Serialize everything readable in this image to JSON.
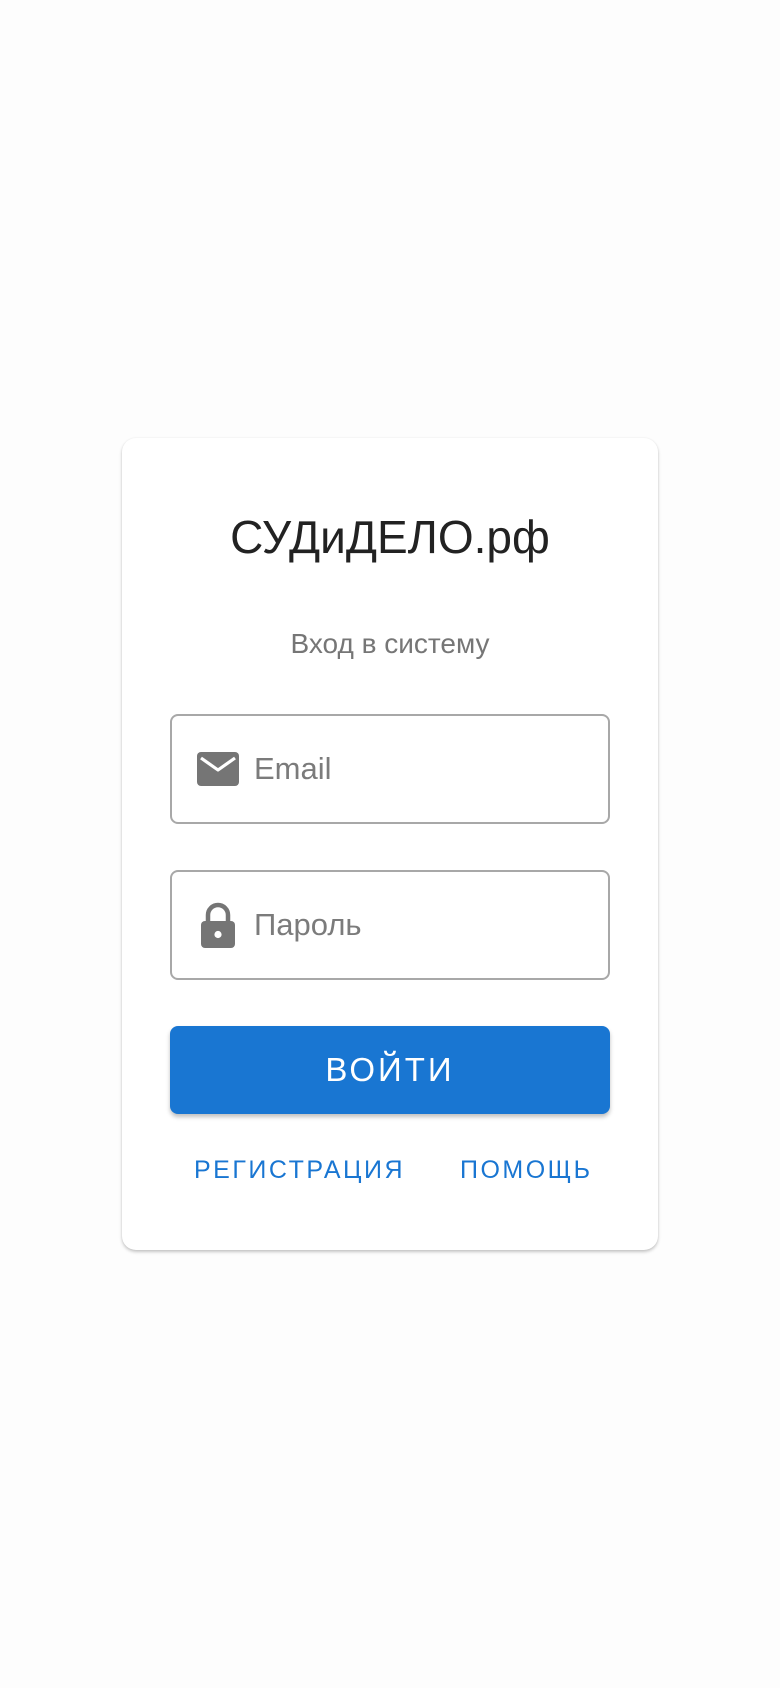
{
  "login_card": {
    "title": "СУДиДЕЛО.рф",
    "subtitle": "Вход в систему",
    "email_field": {
      "icon": "email-icon",
      "placeholder": "Email",
      "value": ""
    },
    "password_field": {
      "icon": "lock-icon",
      "placeholder": "Пароль",
      "value": ""
    },
    "login_button_label": "ВОЙТИ",
    "register_link_label": "РЕГИСТРАЦИЯ",
    "help_link_label": "ПОМОЩЬ"
  },
  "colors": {
    "accent": "#1976d2",
    "title_text": "#222222",
    "muted_text": "#767676",
    "icon": "#757575",
    "field_border": "#a8a8a8",
    "background": "#fdfdfd"
  }
}
